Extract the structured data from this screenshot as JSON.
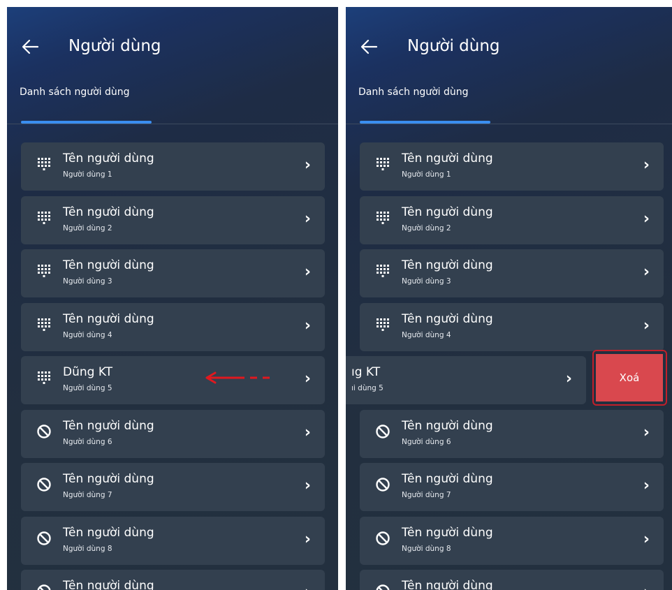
{
  "colors": {
    "accent": "#3a8ef0",
    "row_bg": "#33404f",
    "delete": "#d9484e",
    "arrow": "#e0191f"
  },
  "left": {
    "header": {
      "back_icon": "arrow-left-icon",
      "title": "Người dùng"
    },
    "tab": {
      "label": "Danh sách người dùng"
    },
    "rows": [
      {
        "name": "Tên người dùng",
        "sub": "Người dùng 1",
        "icon": "dialpad-icon"
      },
      {
        "name": "Tên người dùng",
        "sub": "Người dùng 2",
        "icon": "dialpad-icon"
      },
      {
        "name": "Tên người dùng",
        "sub": "Người dùng 3",
        "icon": "dialpad-icon"
      },
      {
        "name": "Tên người dùng",
        "sub": "Người dùng 4",
        "icon": "dialpad-icon"
      },
      {
        "name": "Dũng KT",
        "sub": "Người dùng 5",
        "icon": "dialpad-icon"
      },
      {
        "name": "Tên người dùng",
        "sub": "Người dùng 6",
        "icon": "block-icon"
      },
      {
        "name": "Tên người dùng",
        "sub": "Người dùng 7",
        "icon": "block-icon"
      },
      {
        "name": "Tên người dùng",
        "sub": "Người dùng 8",
        "icon": "block-icon"
      },
      {
        "name": "Tên người dùng",
        "sub": "",
        "icon": "block-icon"
      }
    ]
  },
  "right": {
    "header": {
      "back_icon": "arrow-left-icon",
      "title": "Người dùng"
    },
    "tab": {
      "label": "Danh sách người dùng"
    },
    "rows": [
      {
        "name": "Tên người dùng",
        "sub": "Người dùng 1",
        "icon": "dialpad-icon"
      },
      {
        "name": "Tên người dùng",
        "sub": "Người dùng 2",
        "icon": "dialpad-icon"
      },
      {
        "name": "Tên người dùng",
        "sub": "Người dùng 3",
        "icon": "dialpad-icon"
      },
      {
        "name": "Tên người dùng",
        "sub": "Người dùng 4",
        "icon": "dialpad-icon"
      },
      {
        "name": "ıg KT",
        "sub": "ıi dùng 5",
        "icon": ""
      },
      {
        "name": "Tên người dùng",
        "sub": "Người dùng 6",
        "icon": "block-icon"
      },
      {
        "name": "Tên người dùng",
        "sub": "Người dùng 7",
        "icon": "block-icon"
      },
      {
        "name": "Tên người dùng",
        "sub": "Người dùng 8",
        "icon": "block-icon"
      },
      {
        "name": "Tên người dùng",
        "sub": "",
        "icon": "block-icon"
      }
    ],
    "delete_label": "Xoá"
  },
  "chevron": "›"
}
